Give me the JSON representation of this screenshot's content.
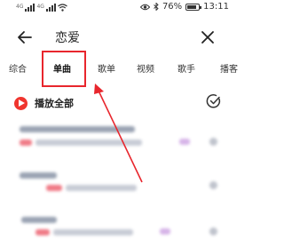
{
  "status_bar": {
    "left_small_a": "4G",
    "left_small_b": "4G",
    "battery_percent": "76%",
    "time": "13:11"
  },
  "search": {
    "query": "恋爱"
  },
  "tabs": [
    {
      "label": "综合",
      "active": false
    },
    {
      "label": "单曲",
      "active": true
    },
    {
      "label": "歌单",
      "active": false
    },
    {
      "label": "视频",
      "active": false
    },
    {
      "label": "歌手",
      "active": false
    },
    {
      "label": "播客",
      "active": false
    }
  ],
  "play_all": {
    "label": "播放全部"
  },
  "colors": {
    "accent": "#e8262d",
    "play_button": "#f0352e"
  },
  "icons": {
    "back": "arrow-left-icon",
    "close": "close-icon",
    "play": "play-circle-icon",
    "multiselect": "checkmark-circle-icon",
    "eye": "eye-icon",
    "wifi": "wifi-icon",
    "signal": "signal-icon",
    "battery": "battery-icon"
  }
}
